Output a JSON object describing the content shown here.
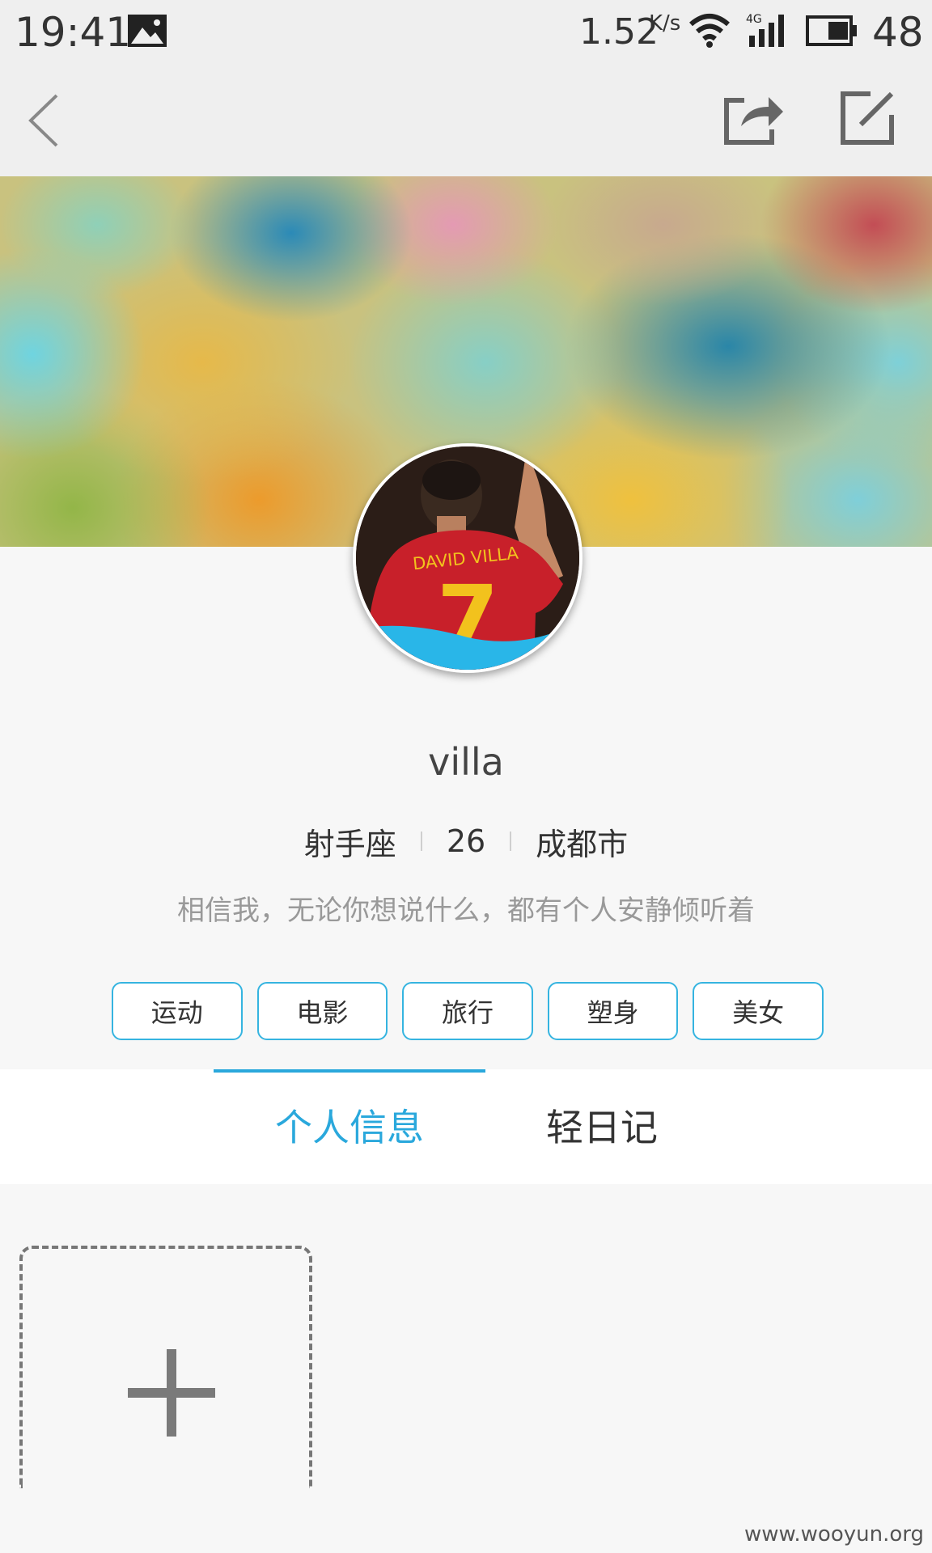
{
  "status_bar": {
    "time": "19:41",
    "net_speed": "1.52",
    "net_speed_unit": "K/s",
    "signal_label": "4G",
    "battery": "48",
    "icons": [
      "image-icon",
      "wifi-icon",
      "signal-icon",
      "battery-icon"
    ]
  },
  "nav": {
    "icons": [
      "back-icon",
      "share-icon",
      "edit-icon"
    ]
  },
  "profile": {
    "avatar_jersey_name": "DAVID VILLA",
    "avatar_jersey_number": "7",
    "username": "villa",
    "zodiac": "射手座",
    "age": "26",
    "city": "成都市",
    "bio": "相信我，无论你想说什么，都有个人安静倾听着",
    "tags": [
      "运动",
      "电影",
      "旅行",
      "塑身",
      "美女"
    ]
  },
  "tabs": [
    {
      "label": "个人信息",
      "active": true
    },
    {
      "label": "轻日记",
      "active": false
    }
  ],
  "add_photo": {
    "icon": "plus-icon"
  },
  "watermark": "www.wooyun.org",
  "colors": {
    "accent": "#2aa8dc",
    "tag_border": "#35b4e0"
  }
}
